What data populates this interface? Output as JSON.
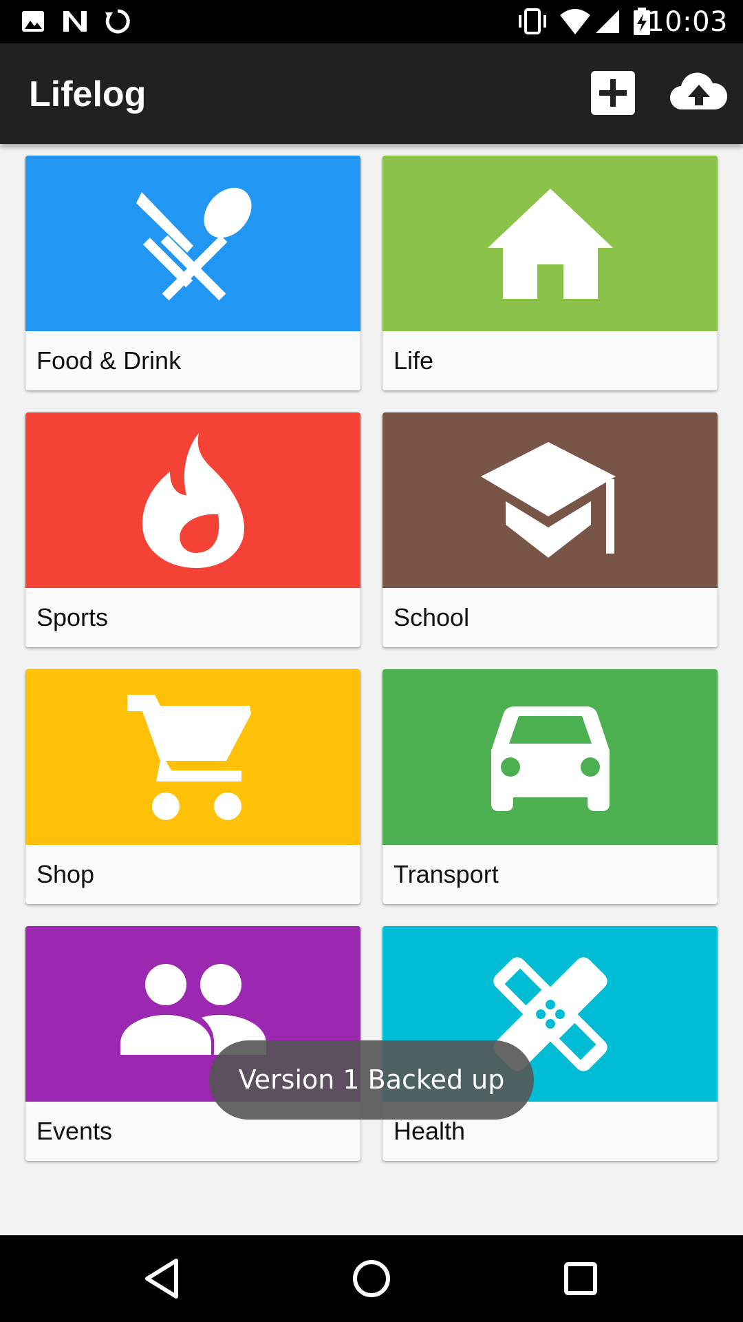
{
  "status_bar": {
    "time": "10:03",
    "left_icons": [
      "image-icon",
      "n-logo-icon",
      "sync-icon"
    ],
    "right_icons": [
      "vibrate-icon",
      "wifi-icon",
      "signal-icon",
      "battery-charging-icon"
    ]
  },
  "app_bar": {
    "title": "Lifelog",
    "actions": [
      "add-icon",
      "cloud-upload-icon"
    ]
  },
  "categories": [
    {
      "label": "Food & Drink",
      "color": "#2196F3",
      "icon": "cutlery-icon"
    },
    {
      "label": "Life",
      "color": "#8BC34A",
      "icon": "home-icon"
    },
    {
      "label": "Sports",
      "color": "#F44336",
      "icon": "flame-icon"
    },
    {
      "label": "School",
      "color": "#795548",
      "icon": "graduation-cap-icon"
    },
    {
      "label": "Shop",
      "color": "#FFC107",
      "icon": "shopping-cart-icon"
    },
    {
      "label": "Transport",
      "color": "#4CAF50",
      "icon": "car-icon"
    },
    {
      "label": "Events",
      "color": "#9C27B0",
      "icon": "people-icon"
    },
    {
      "label": "Health",
      "color": "#00BCD4",
      "icon": "bandage-icon"
    }
  ],
  "toast": {
    "text": "Version 1 Backed up"
  },
  "nav_bar": {
    "buttons": [
      "back-icon",
      "home-circle-icon",
      "recents-icon"
    ]
  }
}
